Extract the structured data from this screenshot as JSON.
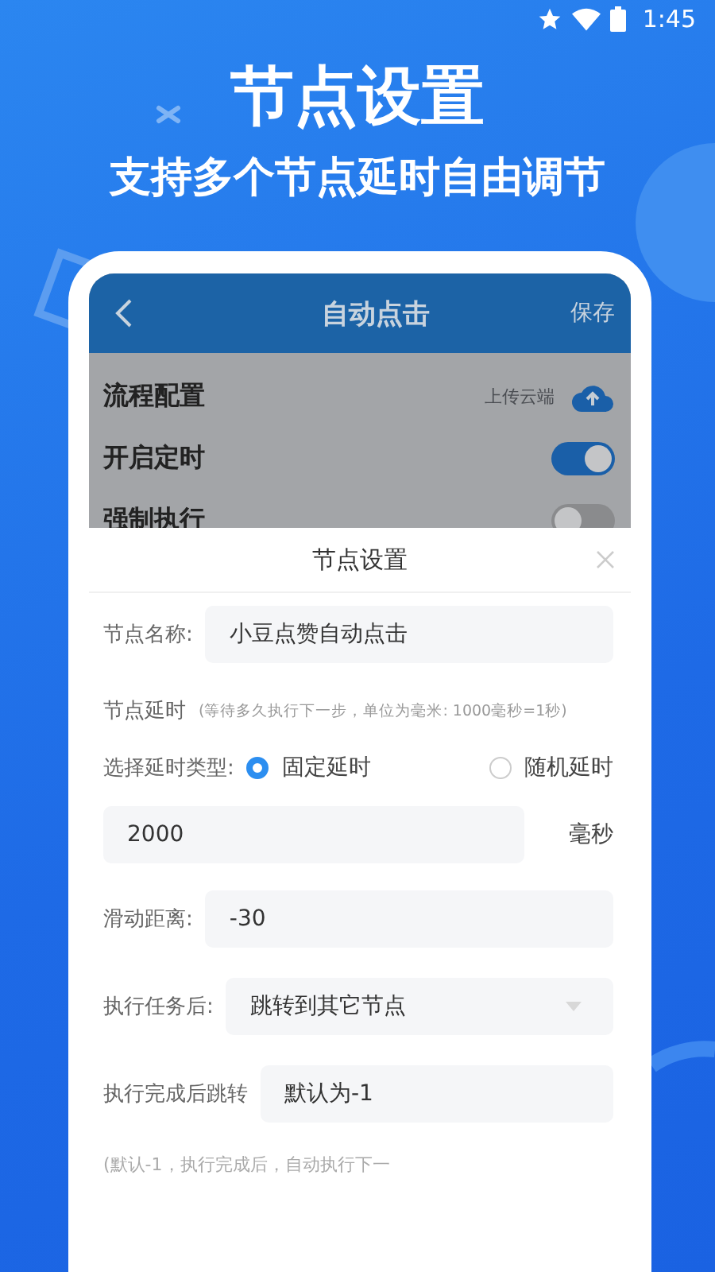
{
  "status_bar": {
    "time": "1:45"
  },
  "headline": "节点设置",
  "subheadline": "支持多个节点延时自由调节",
  "app": {
    "title": "自动点击",
    "save": "保存",
    "rows": [
      {
        "kind": "upload",
        "label": "流程配置",
        "action": "上传云端"
      },
      {
        "kind": "toggle",
        "label": "开启定时",
        "on": true
      },
      {
        "kind": "toggle",
        "label": "强制执行",
        "on": false
      }
    ]
  },
  "sheet": {
    "title": "节点设置",
    "fields": [
      {
        "kind": "input",
        "label": "节点名称:",
        "value": "小豆点赞自动点击"
      },
      {
        "kind": "note",
        "label": "节点延时",
        "hint": "(等待多久执行下一步，单位为毫米: 1000毫秒=1秒)"
      },
      {
        "kind": "radio",
        "label": "选择延时类型:",
        "options": [
          {
            "label": "固定延时",
            "selected": true
          },
          {
            "label": "随机延时",
            "selected": false
          }
        ]
      },
      {
        "kind": "unit",
        "value": "2000",
        "unit": "毫秒"
      },
      {
        "kind": "input",
        "label": "滑动距离:",
        "value": "-30"
      },
      {
        "kind": "select",
        "label": "执行任务后:",
        "value": "跳转到其它节点"
      },
      {
        "kind": "input",
        "label": "执行完成后跳转",
        "value": "默认为-1"
      },
      {
        "kind": "footnote",
        "text": "(默认-1，执行完成后，自动执行下一"
      }
    ]
  }
}
